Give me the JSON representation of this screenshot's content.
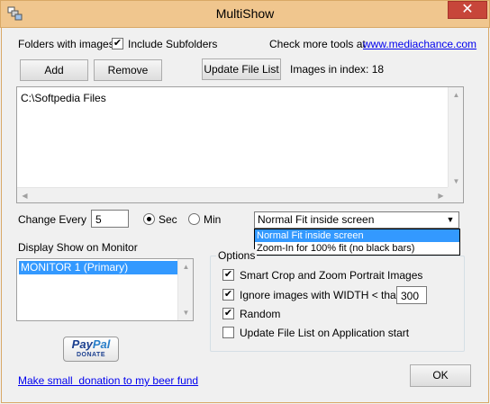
{
  "window": {
    "title": "MultiShow",
    "close_glyph": "✕",
    "accent_color": "#f0c68e",
    "close_color": "#c7463a"
  },
  "folders": {
    "label": "Folders with images",
    "include_subfolders_label": "Include Subfolders",
    "include_subfolders_checked": true,
    "check_more_label": "Check more tools at",
    "site_link": "www.mediachance.com",
    "add_label": "Add",
    "remove_label": "Remove",
    "update_label": "Update File List",
    "index_label": "Images in index: 18",
    "items": [
      "C:\\Softpedia Files"
    ]
  },
  "timing": {
    "change_every_label": "Change Every",
    "value": "5",
    "unit_sec_label": "Sec",
    "unit_min_label": "Min",
    "selected_unit": "Sec"
  },
  "fit_mode": {
    "selected": "Normal Fit inside screen",
    "options": [
      "Normal Fit inside screen",
      "Zoom-In for 100% fit (no black bars)"
    ]
  },
  "monitor": {
    "label": "Display Show on Monitor",
    "items": [
      "MONITOR 1 (Primary)"
    ]
  },
  "options": {
    "title": "Options",
    "smart_crop_label": "Smart Crop and Zoom Portrait Images",
    "smart_crop_checked": true,
    "ignore_width_label": "Ignore images with WIDTH < than",
    "ignore_width_checked": true,
    "ignore_width_value": "300",
    "random_label": "Random",
    "random_checked": true,
    "update_on_start_label": "Update File List on Application start",
    "update_on_start_checked": false
  },
  "footer": {
    "paypal_pay": "Pay",
    "paypal_pal": "Pal",
    "paypal_donate": "DONATE",
    "donate_link": "Make small  donation to my beer fund",
    "ok_label": "OK"
  }
}
